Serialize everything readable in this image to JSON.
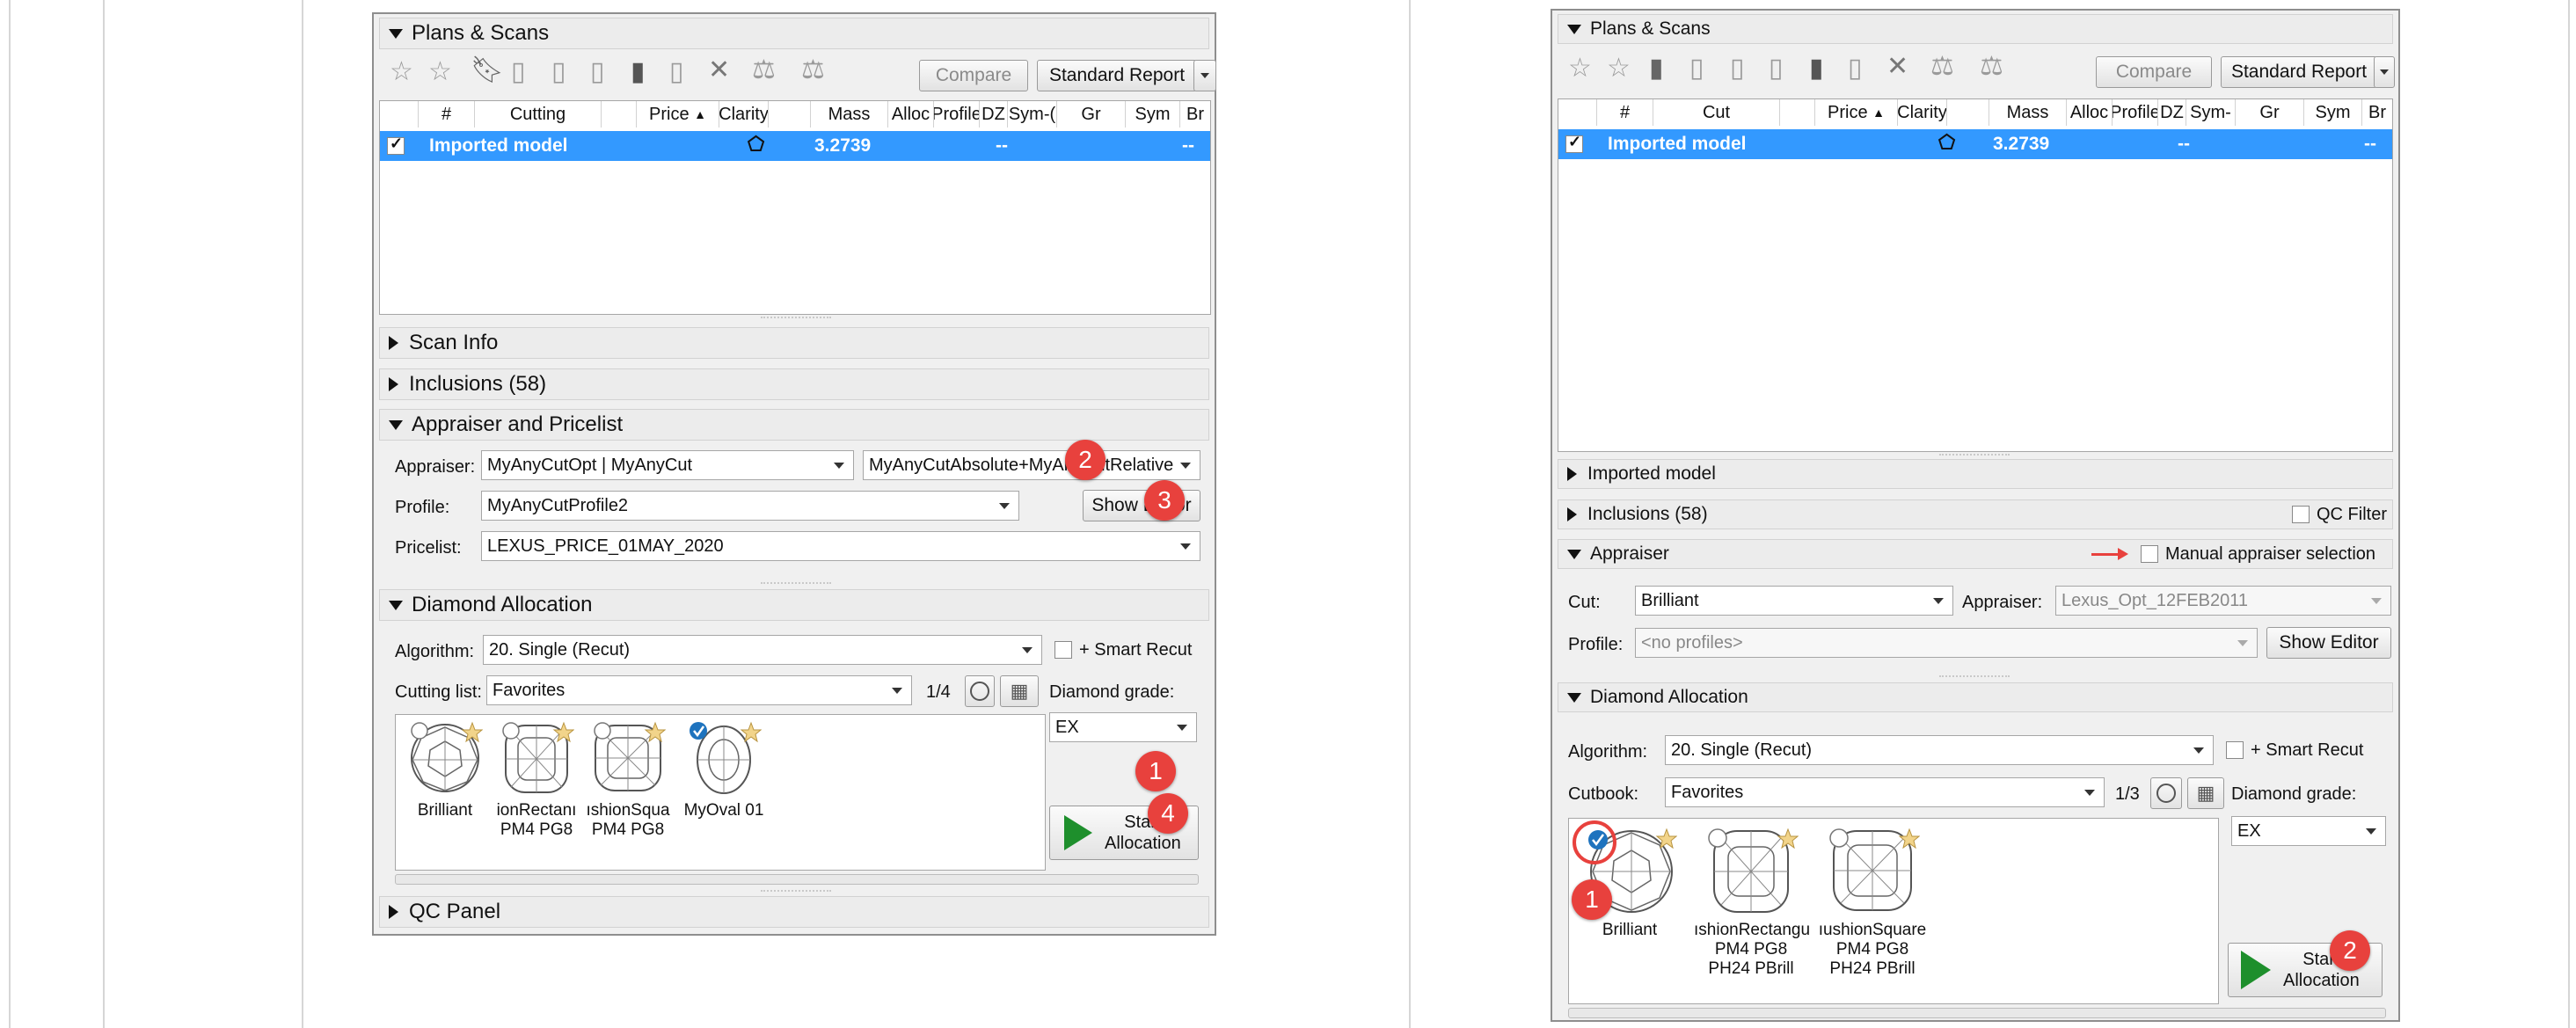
{
  "colors": {
    "selection": "#3399ff",
    "badge": "#e8413d",
    "play": "#1e8f2c",
    "checked_radio": "#1e73be"
  },
  "left": {
    "plans_scans": {
      "title": "Plans & Scans",
      "compare": "Compare",
      "standard_report": "Standard Report",
      "columns": [
        "#",
        "Cutting",
        "Price",
        "Clarity",
        "Mass",
        "Alloc",
        "Profile",
        "DZ",
        "Sym-(",
        "Gr",
        "Sym",
        "Br"
      ],
      "row": {
        "name": "Imported model",
        "mass": "3.2739",
        "dash1": "--",
        "dash2": "--"
      }
    },
    "scan_info": "Scan Info",
    "inclusions": "Inclusions (58)",
    "appraiser_section": {
      "title": "Appraiser and Pricelist",
      "appraiser_label": "Appraiser:",
      "appraiser_value": "MyAnyCutOpt | MyAnyCut",
      "appraiser_value2": "MyAnyCutAbsolute+MyAnyCutRelative",
      "profile_label": "Profile:",
      "profile_value": "MyAnyCutProfile2",
      "show_editor": "Show Editor",
      "pricelist_label": "Pricelist:",
      "pricelist_value": "LEXUS_PRICE_01MAY_2020"
    },
    "allocation": {
      "title": "Diamond Allocation",
      "algorithm_label": "Algorithm:",
      "algorithm_value": "20. Single (Recut)",
      "smart_recut": "+ Smart Recut",
      "cutting_list_label": "Cutting list:",
      "cutting_list_value": "Favorites",
      "page": "1/4",
      "grade_label": "Diamond grade:",
      "grade_value": "EX",
      "diamonds": [
        {
          "l1": "Brilliant",
          "l2": ""
        },
        {
          "l1": "ionRectanı",
          "l2": "PM4 PG8"
        },
        {
          "l1": "ıshionSqua",
          "l2": "PM4 PG8"
        },
        {
          "l1": "MyOval 01",
          "l2": ""
        }
      ],
      "start": "Start",
      "allocation": "Allocation"
    },
    "qc_panel": "QC Panel",
    "badges": [
      "1",
      "2",
      "3",
      "4"
    ]
  },
  "right": {
    "plans_scans": {
      "title": "Plans & Scans",
      "compare": "Compare",
      "standard_report": "Standard Report",
      "columns": [
        "#",
        "Cut",
        "Price",
        "Clarity",
        "Mass",
        "Alloc",
        "Profile",
        "DZ",
        "Sym-",
        "Gr",
        "Sym",
        "Br"
      ],
      "row": {
        "name": "Imported model",
        "mass": "3.2739",
        "dash1": "--",
        "dash2": "--"
      }
    },
    "imported_model": "Imported model",
    "inclusions": "Inclusions (58)",
    "qc_filter": "QC Filter",
    "appraiser_section": {
      "title": "Appraiser",
      "manual": "Manual appraiser selection",
      "cut_label": "Cut:",
      "cut_value": "Brilliant",
      "appraiser_label": "Appraiser:",
      "appraiser_value": "Lexus_Opt_12FEB2011",
      "profile_label": "Profile:",
      "profile_value": "<no profiles>",
      "show_editor": "Show Editor"
    },
    "allocation": {
      "title": "Diamond Allocation",
      "algorithm_label": "Algorithm:",
      "algorithm_value": "20. Single (Recut)",
      "smart_recut": "+ Smart Recut",
      "cutbook_label": "Cutbook:",
      "cutbook_value": "Favorites",
      "page": "1/3",
      "grade_label": "Diamond grade:",
      "grade_value": "EX",
      "diamonds": [
        {
          "l1": "Brilliant",
          "l2": "",
          "l3": ""
        },
        {
          "l1": "ıshionRectangu",
          "l2": "PM4 PG8",
          "l3": "PH24 PBrill"
        },
        {
          "l1": "ıushionSquare",
          "l2": "PM4 PG8",
          "l3": "PH24 PBrill"
        }
      ],
      "start": "Start",
      "allocation": "Allocation"
    },
    "badges": [
      "1",
      "2"
    ]
  }
}
